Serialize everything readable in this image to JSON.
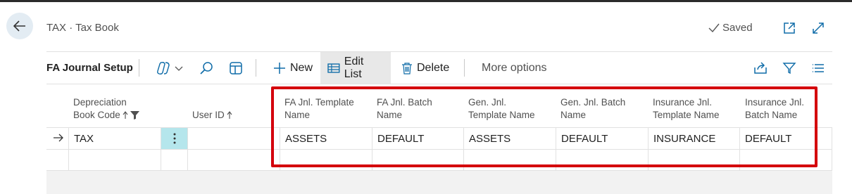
{
  "header": {
    "breadcrumb": "TAX · Tax Book",
    "saved_label": "Saved"
  },
  "toolbar": {
    "page_title": "FA Journal Setup",
    "new_label": "New",
    "edit_list_label": "Edit List",
    "delete_label": "Delete",
    "more_options_label": "More options"
  },
  "grid": {
    "columns": [
      {
        "line1": "Depreciation",
        "line2": "Book Code"
      },
      {
        "line1": "",
        "line2": "User ID"
      },
      {
        "line1": "FA Jnl. Template",
        "line2": "Name"
      },
      {
        "line1": "FA Jnl. Batch",
        "line2": "Name"
      },
      {
        "line1": "Gen. Jnl.",
        "line2": "Template Name"
      },
      {
        "line1": "Gen. Jnl. Batch",
        "line2": "Name"
      },
      {
        "line1": "Insurance Jnl.",
        "line2": "Template Name"
      },
      {
        "line1": "Insurance Jnl.",
        "line2": "Batch Name"
      }
    ],
    "rows": [
      {
        "depreciation_book_code": "TAX",
        "user_id": "",
        "fa_jnl_template_name": "ASSETS",
        "fa_jnl_batch_name": "DEFAULT",
        "gen_jnl_template_name": "ASSETS",
        "gen_jnl_batch_name": "DEFAULT",
        "insurance_jnl_template_name": "INSURANCE",
        "insurance_jnl_batch_name": "DEFAULT"
      }
    ]
  },
  "colors": {
    "highlight": "#d4000c",
    "selected_cell": "#b5e6ec",
    "accent": "#0f6ca8"
  }
}
